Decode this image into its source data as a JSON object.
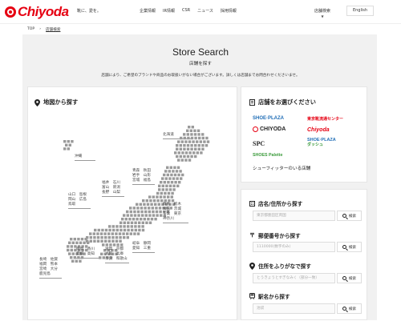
{
  "header": {
    "logo_text": "Chiyoda",
    "tagline": "靴に、愛を。",
    "nav": [
      "企業情報",
      "IR情報",
      "CSR",
      "ニュース",
      "採用情報"
    ],
    "store_search": "店舗検索",
    "lang": "English"
  },
  "breadcrumb": {
    "home": "TOP",
    "current": "店舗検索"
  },
  "page": {
    "title": "Store Search",
    "subtitle": "店舗を探す",
    "lead": "店舗により、ご希望のブランドや商品のお取扱いがない場合がございます。詳しくは店舗までお問合わせくださいませ。"
  },
  "map": {
    "heading": "地図から探す",
    "regions": {
      "hokkaido": "北海道",
      "okinawa": "沖縄",
      "tohoku_1": "青森　秋田",
      "tohoku_2": "岩手　山形",
      "tohoku_3": "宮城　福島",
      "hokuriku_1": "福井　石川",
      "hokuriku_2": "富山　新潟",
      "hokuriku_3": "長野　山梨",
      "chugoku_1": "山口　島根",
      "chugoku_2": "岡山　広島",
      "chugoku_3": "鳥取",
      "kanto_1": "群馬　栃木",
      "kanto_2": "埼玉　茨城",
      "kanto_3": "千葉　東京",
      "kanto_4": "神奈川",
      "tokai_1": "岐阜　静岡",
      "tokai_2": "愛知　三重",
      "shikoku_1": "徳島　香川",
      "shikoku_2": "愛媛　高知",
      "kinki_1": "滋賀　京都",
      "kinki_2": "大阪　兵庫",
      "kinki_3": "奈良　和歌山",
      "kyushu_1": "長崎　佐賀",
      "kyushu_2": "福岡　熊本",
      "kyushu_3": "宮崎　大分",
      "kyushu_4": "鹿児島"
    }
  },
  "brands": {
    "heading": "店舗をお選びください",
    "items": {
      "shoe_plaza": "SHOE·PLAZA",
      "tokyo": "東京靴流通センター",
      "chiyoda_logo": "CHIYODA",
      "chiyoda": "Chiyoda",
      "spc": "SPC",
      "shoe_plaza_dash": "SHOE·PLAZA",
      "shoe_plaza_dash_sub": "ダッシュ",
      "palette": "SHOES Palette",
      "fitter": "シューフィッターのいる店舗"
    },
    "colors": {
      "blue": "#1f6db6",
      "red": "#e60012",
      "green": "#3a9a3a"
    }
  },
  "search": {
    "go_label": "検索",
    "name": {
      "heading": "店名/住所から探す",
      "placeholder": "東京都墨田区両国"
    },
    "zip": {
      "heading": "郵便番号から探す",
      "placeholder": "1110000(数字のみ)"
    },
    "kana": {
      "heading": "住所をふりがなで探す",
      "placeholder": "とうきょうとすぎなみく（部分一致）"
    },
    "station": {
      "heading": "駅名から探す",
      "placeholder": "池袋"
    }
  }
}
